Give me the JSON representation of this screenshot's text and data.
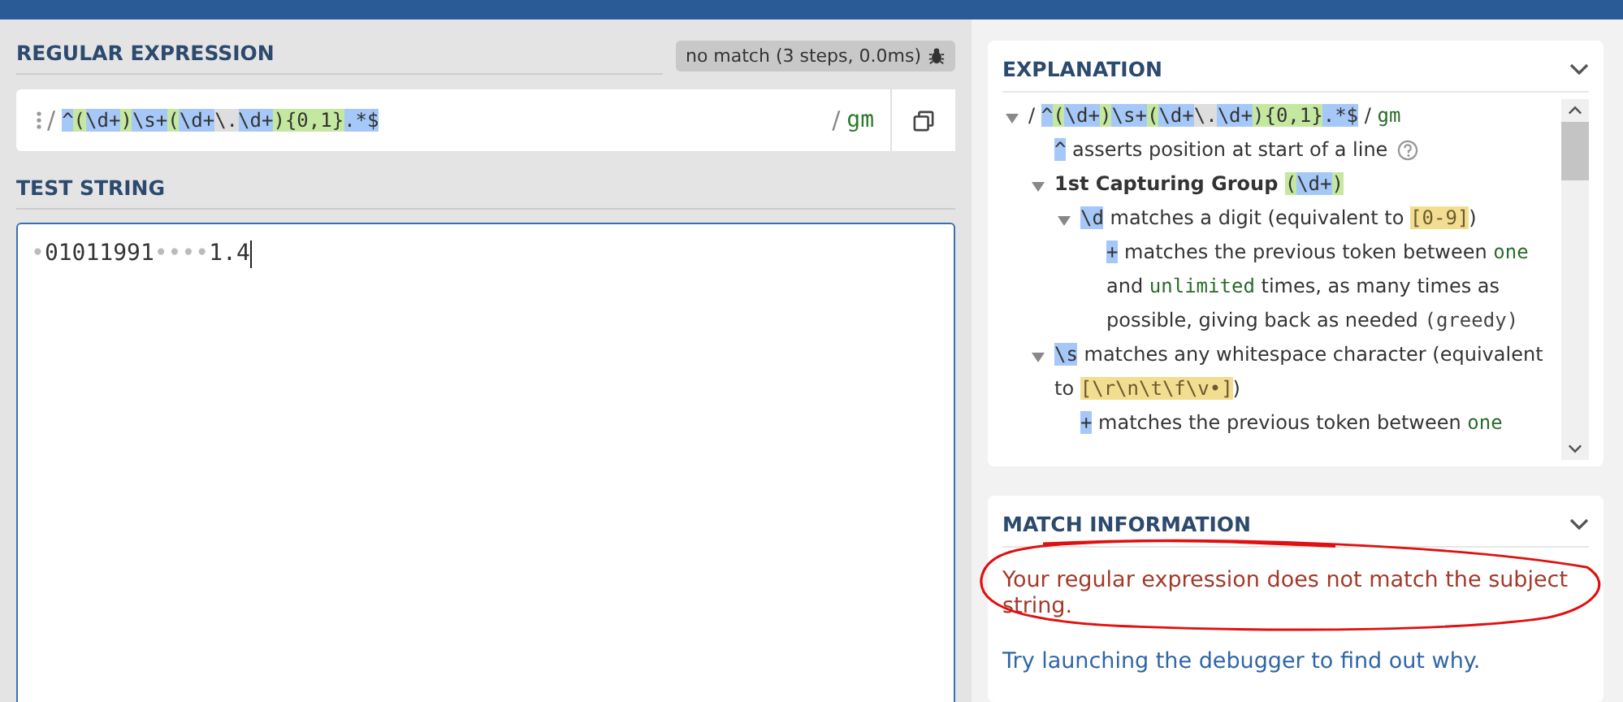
{
  "regex_section": {
    "label": "REGULAR EXPRESSION",
    "status": "no match (3 steps, 0.0ms)"
  },
  "regex": {
    "delimiter_open": "/",
    "tokens": [
      {
        "kind": "meta",
        "text": "^"
      },
      {
        "kind": "group",
        "text": "("
      },
      {
        "kind": "meta",
        "text": "\\d+"
      },
      {
        "kind": "group",
        "text": ")"
      },
      {
        "kind": "meta",
        "text": "\\s+"
      },
      {
        "kind": "group",
        "text": "("
      },
      {
        "kind": "meta",
        "text": "\\d+"
      },
      {
        "kind": "escape",
        "text": "\\."
      },
      {
        "kind": "meta",
        "text": "\\d+"
      },
      {
        "kind": "group",
        "text": ")"
      },
      {
        "kind": "group",
        "text": "{0,1}"
      },
      {
        "kind": "meta",
        "text": ".*$"
      }
    ],
    "delimiter_close": "/",
    "flags": "gm"
  },
  "test_string": {
    "label": "TEST STRING",
    "segments": [
      {
        "kind": "whitespace",
        "text": "•"
      },
      {
        "kind": "text",
        "text": "01011991"
      },
      {
        "kind": "whitespace",
        "text": "••••"
      },
      {
        "kind": "text",
        "text": "1.4"
      }
    ]
  },
  "explanation": {
    "title": "EXPLANATION",
    "tree": [
      {
        "kind": "node",
        "expanded": true,
        "segments": [
          {
            "kind": "text",
            "text": "/ "
          },
          {
            "kind": "meta",
            "text": "^"
          },
          {
            "kind": "group",
            "text": "("
          },
          {
            "kind": "meta",
            "text": "\\d+"
          },
          {
            "kind": "group",
            "text": ")"
          },
          {
            "kind": "meta",
            "text": "\\s+"
          },
          {
            "kind": "group",
            "text": "("
          },
          {
            "kind": "meta",
            "text": "\\d+"
          },
          {
            "kind": "escape",
            "text": "\\."
          },
          {
            "kind": "meta",
            "text": "\\d+"
          },
          {
            "kind": "group",
            "text": ")"
          },
          {
            "kind": "group",
            "text": "{0,1}"
          },
          {
            "kind": "meta",
            "text": ".*$"
          },
          {
            "kind": "text",
            "text": " / "
          },
          {
            "kind": "flag",
            "text": "gm"
          }
        ],
        "children": [
          {
            "kind": "leaf",
            "help": true,
            "segments": [
              {
                "kind": "meta",
                "text": "^"
              },
              {
                "kind": "text",
                "text": " asserts position at start of a line"
              }
            ]
          },
          {
            "kind": "node",
            "expanded": true,
            "segments": [
              {
                "kind": "bold",
                "text": "1st Capturing Group "
              },
              {
                "kind": "group",
                "text": "("
              },
              {
                "kind": "meta",
                "text": "\\d+"
              },
              {
                "kind": "group",
                "text": ")"
              }
            ],
            "children": [
              {
                "kind": "node",
                "expanded": true,
                "segments": [
                  {
                    "kind": "meta",
                    "text": "\\d"
                  },
                  {
                    "kind": "text",
                    "text": " matches a digit (equivalent to "
                  },
                  {
                    "kind": "class",
                    "text": "[0-9]"
                  },
                  {
                    "kind": "text",
                    "text": ")"
                  }
                ],
                "children": [
                  {
                    "kind": "leaf",
                    "help": false,
                    "segments": [
                      {
                        "kind": "meta",
                        "text": "+"
                      },
                      {
                        "kind": "text",
                        "text": " matches the previous token between "
                      },
                      {
                        "kind": "flag",
                        "text": "one"
                      },
                      {
                        "kind": "text",
                        "text": " and "
                      },
                      {
                        "kind": "flag",
                        "text": "unlimited"
                      },
                      {
                        "kind": "text",
                        "text": " times, as many times as possible, giving back as needed "
                      },
                      {
                        "kind": "code",
                        "text": "(greedy)"
                      }
                    ]
                  }
                ]
              }
            ]
          },
          {
            "kind": "node",
            "expanded": true,
            "segments": [
              {
                "kind": "meta",
                "text": "\\s"
              },
              {
                "kind": "text",
                "text": " matches any whitespace character (equivalent to "
              },
              {
                "kind": "class",
                "text": "[\\r\\n\\t\\f\\v•]"
              },
              {
                "kind": "text",
                "text": ")"
              }
            ],
            "children": [
              {
                "kind": "leaf",
                "help": false,
                "segments": [
                  {
                    "kind": "meta",
                    "text": "+"
                  },
                  {
                    "kind": "text",
                    "text": " matches the previous token between "
                  },
                  {
                    "kind": "flag",
                    "text": "one"
                  }
                ]
              }
            ]
          }
        ]
      }
    ]
  },
  "match_information": {
    "title": "MATCH INFORMATION",
    "message": "Your regular expression does not match the subject string.",
    "hint": "Try launching the debugger to find out why."
  }
}
